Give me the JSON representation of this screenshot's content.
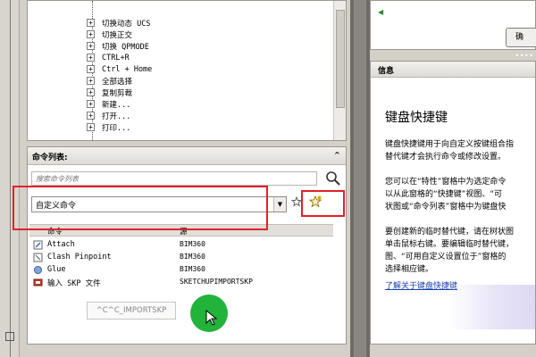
{
  "tree": {
    "items": [
      {
        "label": "切换动态 UCS"
      },
      {
        "label": "切换正交"
      },
      {
        "label": "切换 QPMODE"
      },
      {
        "label": "CTRL+R"
      },
      {
        "label": "Ctrl + Home"
      },
      {
        "label": "全部选择"
      },
      {
        "label": "复制剪裁"
      },
      {
        "label": "新建..."
      },
      {
        "label": "打开..."
      },
      {
        "label": "打印..."
      }
    ]
  },
  "command_list": {
    "title": "命令列表:",
    "search_placeholder": "搜索命令列表",
    "filter_value": "自定义命令",
    "columns": {
      "command": "命令",
      "source": "源"
    },
    "rows": [
      {
        "name": "Attach",
        "source": "BIM360",
        "icon": "attach-icon"
      },
      {
        "name": "Clash Pinpoint",
        "source": "BIM360",
        "icon": "clash-icon"
      },
      {
        "name": "Glue",
        "source": "BIM360",
        "icon": "glue-icon"
      },
      {
        "name": "输入 SKP 文件",
        "source": "SKETCHUPIMPORTSKP",
        "icon": "skp-import-icon"
      }
    ],
    "tooltip": "^C^C_IMPORTSKP"
  },
  "top_right": {
    "button_label": "确"
  },
  "info": {
    "header": "信息",
    "title": "键盘快捷键",
    "paragraph1": [
      "键盘快捷键用于向自定义按键组合指",
      "替代键才会执行命令或修改设置。"
    ],
    "paragraph2": [
      "您可以在“特性”窗格中为选定命令",
      "以从此窗格的“快捷键”视图、“可",
      "状图或“命令列表”窗格中为键盘快"
    ],
    "paragraph3": [
      "要创建新的临时替代键，请在树状图",
      "单击鼠标右键。要编辑临时替代键，",
      "图、“可用自定义设置位于”窗格的",
      "选择相应键。"
    ],
    "link": "了解关于键盘快捷键"
  },
  "colors": {
    "highlight_red": "#e3202b",
    "cursor_green": "#22b33a",
    "link_blue": "#1a3fb0"
  }
}
